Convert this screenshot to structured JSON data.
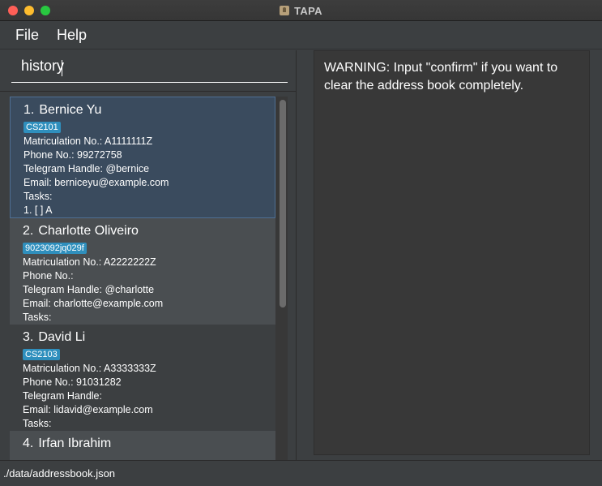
{
  "window": {
    "title": "TAPA",
    "app_icon": "tapa-app-icon"
  },
  "menu": {
    "file": "File",
    "help": "Help"
  },
  "command_box": {
    "value": "history"
  },
  "persons": [
    {
      "index": "1.",
      "name": "Bernice Yu",
      "tag": "CS2101",
      "matric": "Matriculation No.: A1111111Z",
      "phone": "Phone No.: 99272758",
      "telegram": "Telegram Handle: @bernice",
      "email": "Email: berniceyu@example.com",
      "tasks_label": "Tasks:",
      "tasks": [
        "1. [ ] A"
      ]
    },
    {
      "index": "2.",
      "name": "Charlotte Oliveiro",
      "tag": "9023092jq029f",
      "matric": "Matriculation No.: A2222222Z",
      "phone": "Phone No.:",
      "telegram": "Telegram Handle: @charlotte",
      "email": "Email: charlotte@example.com",
      "tasks_label": "Tasks:",
      "tasks": []
    },
    {
      "index": "3.",
      "name": "David Li",
      "tag": "CS2103",
      "matric": "Matriculation No.: A3333333Z",
      "phone": "Phone No.: 91031282",
      "telegram": "Telegram Handle:",
      "email": "Email: lidavid@example.com",
      "tasks_label": "Tasks:",
      "tasks": []
    },
    {
      "index": "4.",
      "name": "Irfan Ibrahim"
    }
  ],
  "result": {
    "message": "WARNING: Input \"confirm\" if you want to clear the address book completely."
  },
  "status": {
    "path": "./data/addressbook.json"
  },
  "colors": {
    "background": "#3c3f41",
    "selected_card": "#3a4b5e",
    "tag": "#2f8fbd"
  }
}
